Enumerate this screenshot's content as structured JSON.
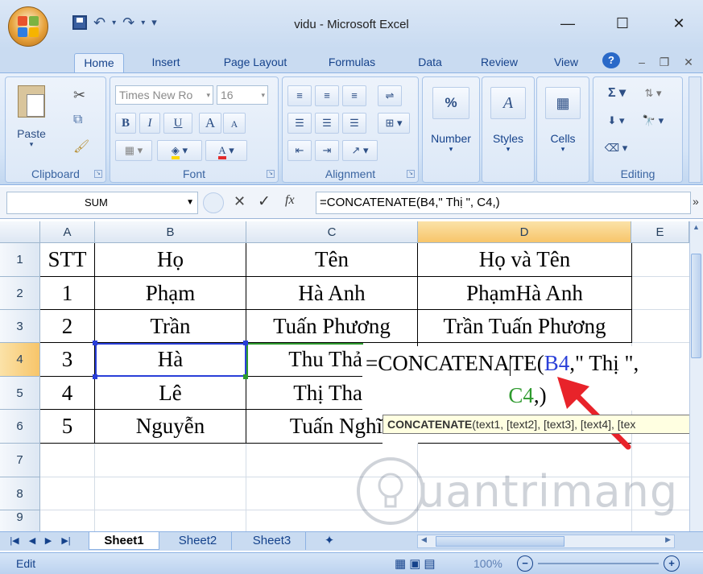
{
  "window": {
    "title": "vidu - Microsoft Excel",
    "minimize": "—",
    "maximize": "☐",
    "close": "✕"
  },
  "qat": {
    "save_icon": "floppy-icon",
    "undo": "↶",
    "redo": "↷",
    "more": "▾"
  },
  "ribbon_tabs": [
    {
      "label": "Home",
      "active": true
    },
    {
      "label": "Insert"
    },
    {
      "label": "Page Layout"
    },
    {
      "label": "Formulas"
    },
    {
      "label": "Data"
    },
    {
      "label": "Review"
    },
    {
      "label": "View"
    }
  ],
  "help": "?",
  "ribbon": {
    "clipboard": {
      "label": "Clipboard",
      "paste": "Paste"
    },
    "font": {
      "label": "Font",
      "font_name": "Times New Ro",
      "font_size": "16",
      "bold": "B",
      "italic": "I",
      "underline": "U",
      "grow": "A",
      "shrink": "A"
    },
    "alignment": {
      "label": "Alignment"
    },
    "number": {
      "label": "Number",
      "icon": "%"
    },
    "styles": {
      "label": "Styles"
    },
    "cells": {
      "label": "Cells"
    },
    "editing": {
      "label": "Editing",
      "sum": "Σ"
    }
  },
  "formula_bar": {
    "name_box": "SUM",
    "cancel": "✕",
    "enter": "✓",
    "fx": "fx",
    "formula": "=CONCATENATE(B4,\" Thị \", C4,)"
  },
  "columns": [
    "A",
    "B",
    "C",
    "D",
    "E"
  ],
  "rows": [
    "1",
    "2",
    "3",
    "4",
    "5",
    "6",
    "7",
    "8",
    "9"
  ],
  "cells": {
    "r1": [
      "STT",
      "Họ",
      "Tên",
      "Họ và Tên"
    ],
    "r2": [
      "1",
      "Phạm",
      "Hà Anh",
      "PhạmHà Anh"
    ],
    "r3": [
      "2",
      "Trần",
      "Tuấn Phương",
      "Trần Tuấn Phương"
    ],
    "r4": [
      "3",
      "Hà",
      "Thu Thả"
    ],
    "r5": [
      "4",
      "Lê",
      "Thị Tha"
    ],
    "r6": [
      "5",
      "Nguyễn",
      "Tuấn Nghĩ"
    ]
  },
  "editor": {
    "prefix": "=CONCATENA",
    "suffix": "TE(",
    "ref1": "B4",
    "mid": ",\" Thị \",",
    "ref2": "C4",
    "end": ",)",
    "ref1_color": "#2a3fd8",
    "ref2_color": "#2e9a2e"
  },
  "tooltip": {
    "fn": "CONCATENATE",
    "args": "(text1, [text2], [text3], [text4], [tex"
  },
  "sheets": [
    {
      "label": "Sheet1",
      "active": true
    },
    {
      "label": "Sheet2"
    },
    {
      "label": "Sheet3"
    }
  ],
  "status": {
    "mode": "Edit",
    "zoom": "100%"
  },
  "watermark": {
    "text": "uantrimang"
  },
  "colors": {
    "accent": "#15428b",
    "arrow": "#e8232a",
    "selected_header": "#f7c56a"
  }
}
